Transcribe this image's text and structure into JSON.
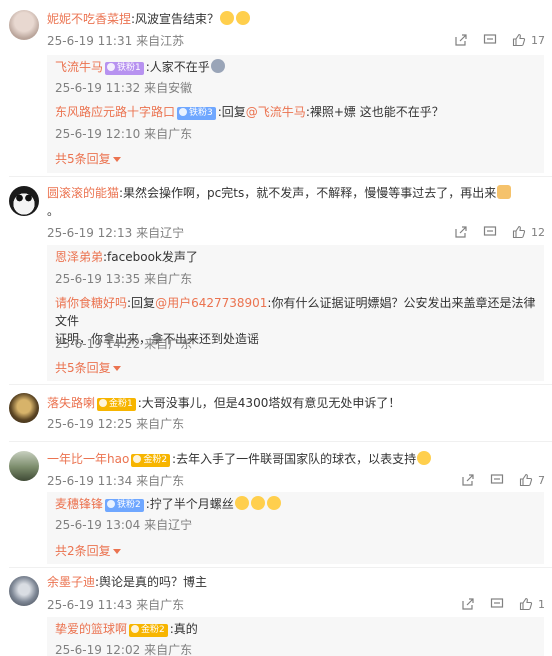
{
  "colors": {
    "accent": "#eb7350",
    "meta": "#808080",
    "reply_bg": "#f7f7f7",
    "badge_purple": "#b792f0",
    "badge_blue": "#6fa7ff",
    "badge_gold": "#f7b500"
  },
  "comments": [
    {
      "user": "妮妮不吃香菜捏",
      "text": ":风波宣告结束？",
      "time": "25-6-19 11:31",
      "location": "来自江苏",
      "likes": "17",
      "replies": [
        {
          "user": "飞流牛马",
          "badge": "铁粉1",
          "text": ":人家不在乎",
          "time": "25-6-19 11:32",
          "location": "来自安徽"
        },
        {
          "user": "东风路应元路十字路口",
          "badge": "铁粉3",
          "text_pre": ":回复",
          "mention": "@飞流牛马",
          "text": ":裸照+嫖 这也能不在乎？",
          "time": "25-6-19 12:10",
          "location": "来自广东"
        }
      ],
      "more": "共5条回复"
    },
    {
      "user": "圆滚滚的能猫",
      "text": ":果然会操作啊，pc完ts，就不发声，不解释，慢慢等事过去了，再出来",
      "text_line2": "。",
      "time": "25-6-19 12:13",
      "location": "来自辽宁",
      "likes": "12",
      "replies": [
        {
          "user": "恩泽弟弟",
          "text": ":facebook发声了",
          "time": "25-6-19 13:35",
          "location": "来自广东"
        },
        {
          "user": "请你食糖好吗",
          "text_pre": ":回复",
          "mention": "@用户6427738901",
          "text": ":你有什么证据证明嫖娼？公安发出来盖章还是法律文件",
          "text_line2": "证明，你拿出来，拿不出来还到处造谣",
          "time": "25-6-19 14:22",
          "location": "来自广东"
        }
      ],
      "more": "共5条回复"
    },
    {
      "user": "落失路喇",
      "badge": "金粉1",
      "text": ":大哥没事儿，但是4300塔奴有意见无处申诉了！",
      "time": "25-6-19 12:25",
      "location": "来自广东",
      "likes": ""
    },
    {
      "user": "一年比一年hao",
      "badge": "金粉2",
      "text": ":去年入手了一件联哥国家队的球衣，以表支持",
      "time": "25-6-19 11:34",
      "location": "来自广东",
      "likes": "7",
      "replies": [
        {
          "user": "麦穗锋锋",
          "badge": "铁粉2",
          "text": ":拧了半个月螺丝",
          "time": "25-6-19 13:04",
          "location": "来自辽宁"
        }
      ],
      "more": "共2条回复"
    },
    {
      "user": "余墨子迪",
      "text": ":舆论是真的吗？博主",
      "time": "25-6-19 11:43",
      "location": "来自广东",
      "likes": "1",
      "replies": [
        {
          "user": "挚爱的篮球啊",
          "badge": "金粉2",
          "text": ":真的",
          "time": "25-6-19 12:02",
          "location": "来自广东"
        }
      ]
    }
  ]
}
